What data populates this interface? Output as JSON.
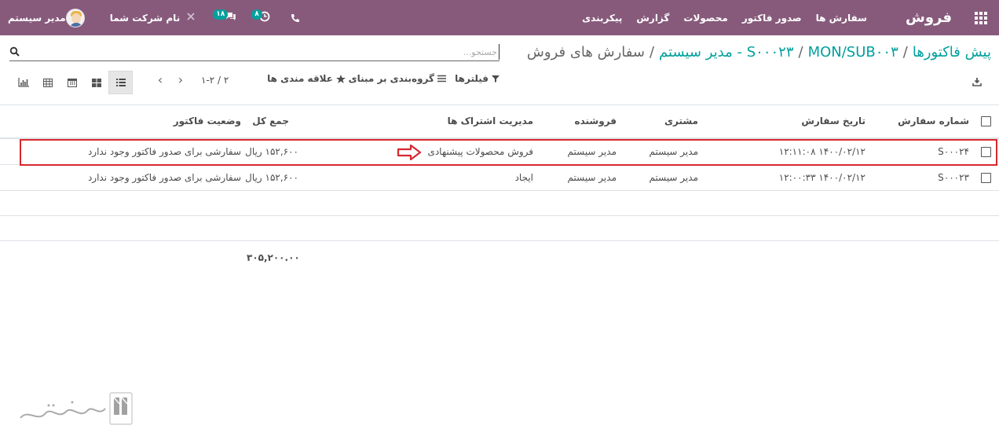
{
  "app": {
    "name": "فروش"
  },
  "menu": [
    {
      "label": "سفارش ها"
    },
    {
      "label": "صدور فاکتور"
    },
    {
      "label": "محصولات"
    },
    {
      "label": "گزارش"
    },
    {
      "label": "پیکربندی"
    }
  ],
  "user": {
    "name": "مدیر سیستم"
  },
  "company": {
    "name": "نام شرکت شما"
  },
  "badges": {
    "messages": "۱۸",
    "activities": "۸"
  },
  "breadcrumb": {
    "items": [
      "پیش فاکتورها",
      "S۰۰۰۲۳",
      "MON/SUB۰۰۳ - مدیر سیستم"
    ],
    "active": "سفارش های فروش"
  },
  "search": {
    "placeholder": "جستجو..."
  },
  "toolbar": {
    "filters": "فیلترها",
    "group_by": "گروه‌بندی بر مبنای",
    "favorites": "علاقه مندی ها"
  },
  "pager": {
    "value": "۱-۲ / ۲"
  },
  "table": {
    "columns": {
      "order_number": "شماره سفارش",
      "order_date": "تاریخ سفارش",
      "customer": "مشتری",
      "salesperson": "فروشنده",
      "subscription": "مدیریت اشتراک ها",
      "total": "جمع کل",
      "invoice_status": "وضعیت فاکتور"
    },
    "rows": [
      {
        "order_number": "S۰۰۰۲۴",
        "order_date": "۱۴۰۰/۰۲/۱۲ ۱۲:۱۱:۰۸",
        "customer": "مدیر سیستم",
        "salesperson": "مدیر سیستم",
        "subscription": "فروش محصولات پیشنهادی",
        "total": "۱۵۲,۶۰۰ ریال",
        "invoice_status": "سفارشی برای صدور فاکتور وجود ندارد"
      },
      {
        "order_number": "S۰۰۰۲۳",
        "order_date": "۱۴۰۰/۰۲/۱۲ ۱۲:۰۰:۳۳",
        "customer": "مدیر سیستم",
        "salesperson": "مدیر سیستم",
        "subscription": "ایجاد",
        "total": "۱۵۲,۶۰۰ ریال",
        "invoice_status": "سفارشی برای صدور فاکتور وجود ندارد"
      }
    ],
    "grand_total": "۳۰۵,۲۰۰.۰۰"
  },
  "colors": {
    "navbar": "#875a7b",
    "accent": "#00a09d",
    "highlight": "#d7282f"
  },
  "icons": [
    "apps-grid-icon",
    "phone-icon",
    "clock-icon",
    "chat-icon",
    "tools-icon",
    "search-icon",
    "filter-icon",
    "list-icon",
    "star-icon",
    "download-icon",
    "chevron-left-icon",
    "chevron-right-icon",
    "list-view-icon",
    "kanban-view-icon",
    "calendar-view-icon",
    "pivot-view-icon",
    "graph-view-icon",
    "arrow-right-outline-icon"
  ]
}
